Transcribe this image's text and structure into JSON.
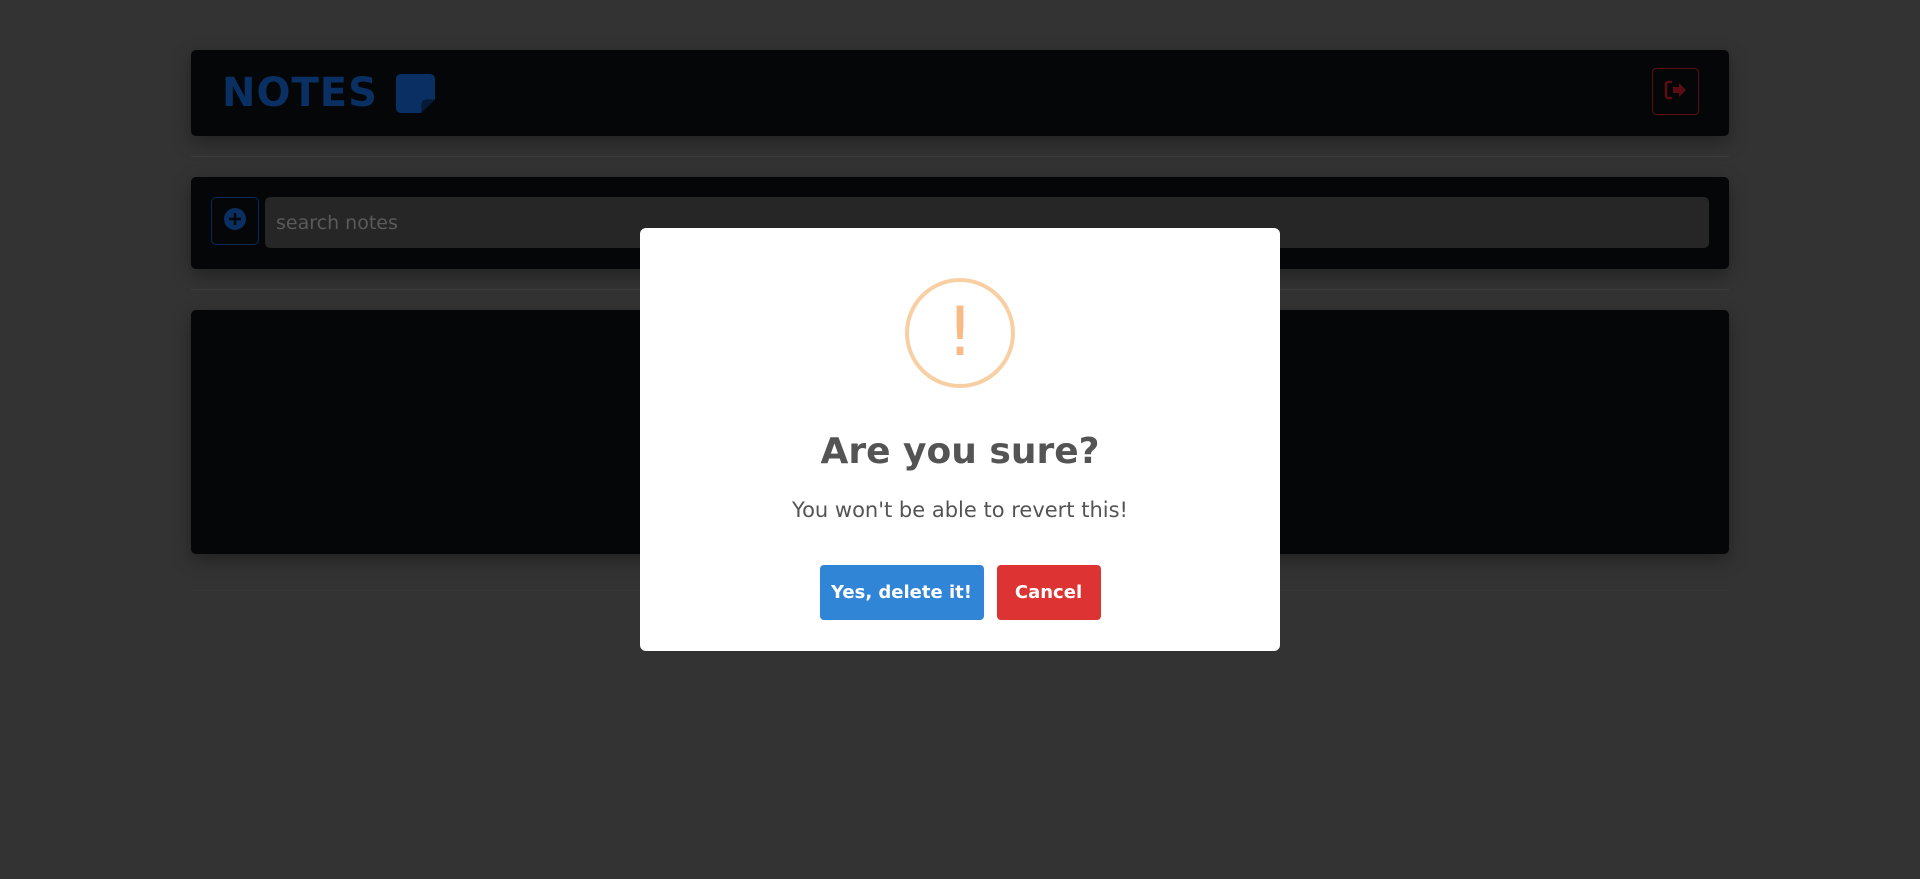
{
  "header": {
    "title": "NOTES",
    "note_icon": "sticky-note-icon",
    "logout_icon": "logout-icon"
  },
  "search": {
    "add_icon": "plus-circle-icon",
    "placeholder": "search notes",
    "value": ""
  },
  "dialog": {
    "icon": "warning-icon",
    "icon_glyph": "!",
    "title": "Are you sure?",
    "text": "You won't be able to revert this!",
    "confirm_label": "Yes, delete it!",
    "cancel_label": "Cancel"
  },
  "colors": {
    "background": "#333333",
    "panel": "#050608",
    "brand": "#0a2f62",
    "confirm": "#3085d6",
    "cancel": "#dd3333",
    "warning": "#f8bb86"
  }
}
